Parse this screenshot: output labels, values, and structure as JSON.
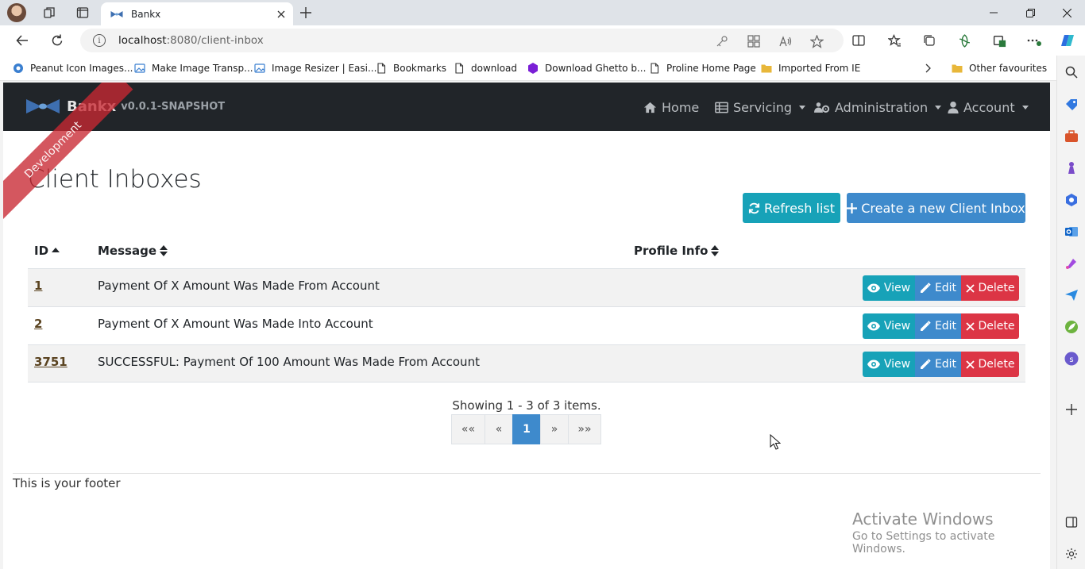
{
  "browser": {
    "tab_title": "Bankx",
    "url_host": "localhost",
    "url_path": ":8080/client-inbox",
    "bookmarks": [
      {
        "label": "Peanut Icon Images..."
      },
      {
        "label": "Make Image Transp..."
      },
      {
        "label": "Image Resizer | Easi..."
      },
      {
        "label": "Bookmarks"
      },
      {
        "label": "download"
      },
      {
        "label": "Download Ghetto b..."
      },
      {
        "label": "Proline Home Page"
      },
      {
        "label": "Imported From IE"
      }
    ],
    "other_favourites": "Other favourites"
  },
  "app": {
    "brand": "Bankx",
    "version": "v0.0.1-SNAPSHOT",
    "ribbon": "Development",
    "nav": {
      "home": "Home",
      "servicing": "Servicing",
      "administration": "Administration",
      "account": "Account"
    }
  },
  "page": {
    "title": "Client Inboxes",
    "refresh_label": "Refresh list",
    "create_label": "Create a new Client Inbox",
    "columns": {
      "id": "ID",
      "message": "Message",
      "profile": "Profile Info"
    },
    "rows": [
      {
        "id": "1",
        "message": "Payment Of X Amount Was Made From Account"
      },
      {
        "id": "2",
        "message": "Payment Of X Amount Was Made Into Account"
      },
      {
        "id": "3751",
        "message": "SUCCESSFUL: Payment Of 100 Amount Was Made From Account"
      }
    ],
    "actions": {
      "view": "View",
      "edit": "Edit",
      "delete": "Delete"
    },
    "showing": "Showing 1 - 3 of 3 items.",
    "pager": {
      "first": "««",
      "prev": "«",
      "current": "1",
      "next": "»",
      "last": "»»"
    },
    "footer": "This is your footer"
  },
  "watermark": {
    "line1": "Activate Windows",
    "line2": "Go to Settings to activate Windows."
  },
  "colors": {
    "navbar": "#212529",
    "info": "#17a2b8",
    "primary": "#3e8acc",
    "danger": "#dc3545"
  }
}
